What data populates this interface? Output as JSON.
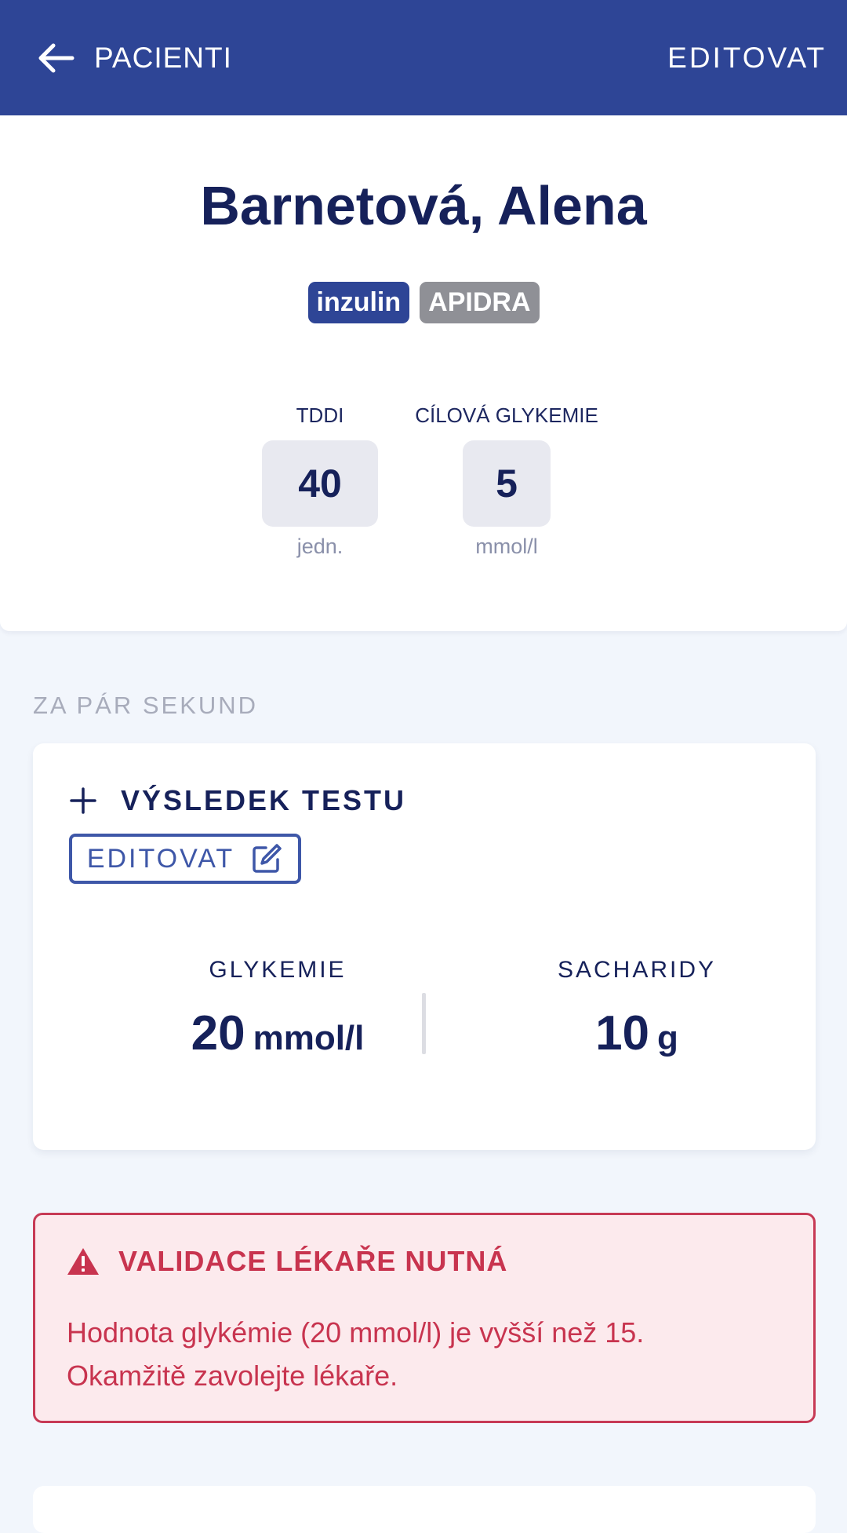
{
  "topbar": {
    "back_label": "PACIENTI",
    "edit_label": "EDITOVAT",
    "background": "#2e4596"
  },
  "patient": {
    "name": "Barnetová, Alena",
    "tags": [
      {
        "label": "inzulin",
        "color": "#2e4596"
      },
      {
        "label": "APIDRA",
        "color": "#8f9096"
      }
    ]
  },
  "stats": {
    "tddi": {
      "label": "TDDI",
      "value": "40",
      "unit": "jedn."
    },
    "target": {
      "label": "CÍLOVÁ GLYKEMIE",
      "value": "5",
      "unit": "mmol/l"
    }
  },
  "section": {
    "time_heading": "ZA PÁR SEKUND"
  },
  "result": {
    "title": "VÝSLEDEK TESTU",
    "edit_label": "EDITOVAT",
    "glycemia": {
      "label": "GLYKEMIE",
      "value": "20",
      "unit": "mmol/l"
    },
    "carbs": {
      "label": "SACHARIDY",
      "value": "10",
      "unit": "g"
    }
  },
  "alert": {
    "title": "VALIDACE LÉKAŘE NUTNÁ",
    "line1": "Hodnota glykémie (20 mmol/l) je vyšší než 15.",
    "line2": "Okamžitě zavolejte lékaře.",
    "color": "#c8344f"
  },
  "icons": {
    "back": "arrow-left-icon",
    "add": "plus-icon",
    "edit": "edit-icon",
    "warning": "warning-icon"
  }
}
